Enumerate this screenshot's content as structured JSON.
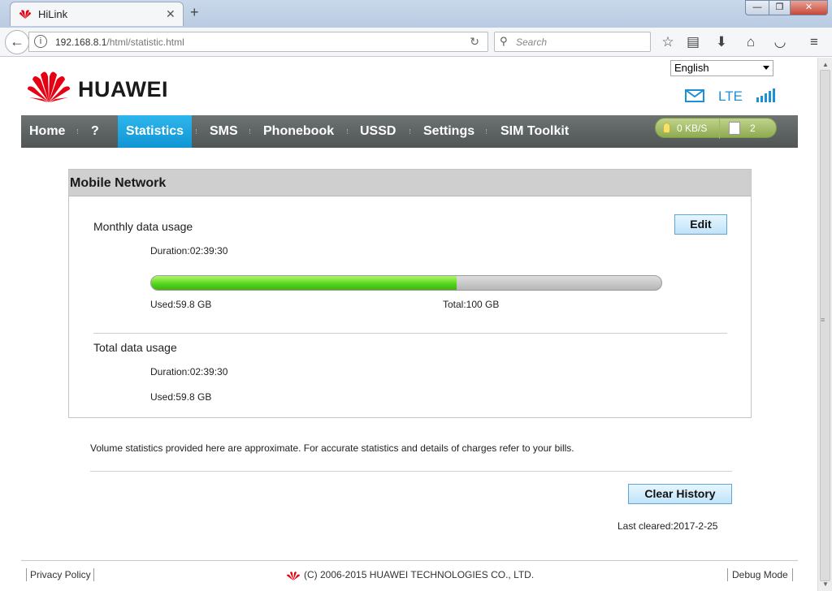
{
  "browser": {
    "tab_title": "HiLink",
    "tab_close": "✕",
    "new_tab": "+",
    "window_min": "—",
    "window_max": "❐",
    "window_close": "✕",
    "url_host": "192.168.8.1",
    "url_path": "/html/statistic.html",
    "search_placeholder": "Search"
  },
  "header": {
    "brand": "HUAWEI",
    "language": "English",
    "network_type": "LTE"
  },
  "nav": {
    "items": [
      {
        "label": "Home"
      },
      {
        "label": "?"
      },
      {
        "label": "Statistics"
      },
      {
        "label": "SMS"
      },
      {
        "label": "Phonebook"
      },
      {
        "label": "USSD"
      },
      {
        "label": "Settings"
      },
      {
        "label": "SIM Toolkit"
      }
    ],
    "active_index": 2
  },
  "status": {
    "speed": "0 KB/S",
    "unread_count": "2",
    "accent_color": "#8dab50"
  },
  "panel": {
    "title": "Mobile Network",
    "monthly": {
      "title": "Monthly data usage",
      "duration": "Duration:02:39:30",
      "used": "Used:59.8 GB",
      "total": "Total:100 GB",
      "edit_label": "Edit",
      "usage_fraction": 0.598
    },
    "total": {
      "title": "Total data usage",
      "duration": "Duration:02:39:30",
      "used": "Used:59.8 GB"
    }
  },
  "disclaimer": "Volume statistics provided here are approximate. For accurate statistics and details of charges refer to your bills.",
  "clear_history_label": "Clear History",
  "last_cleared": "Last cleared:2017-2-25",
  "footer": {
    "privacy": "Privacy Policy",
    "copyright": "(C) 2006-2015 HUAWEI TECHNOLOGIES CO., LTD.",
    "debug": "Debug Mode"
  },
  "colors": {
    "nav_active": "#1aa6e0",
    "progress": "#56d61e",
    "brand_red": "#e60012"
  }
}
